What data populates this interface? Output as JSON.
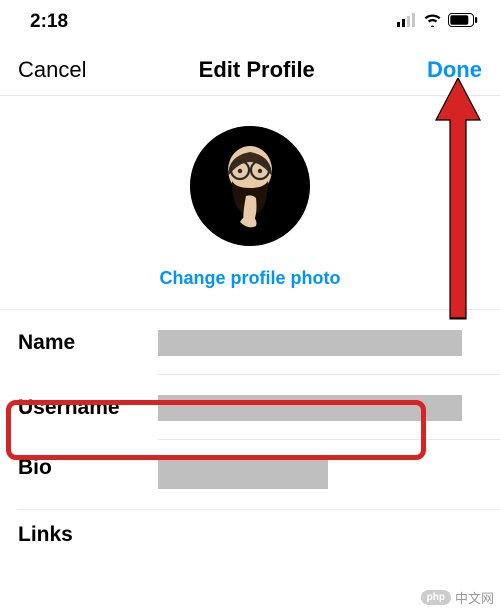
{
  "status": {
    "time": "2:18",
    "signal_icon": "signal",
    "wifi_icon": "wifi",
    "battery_icon": "battery"
  },
  "nav": {
    "cancel": "Cancel",
    "title": "Edit Profile",
    "done": "Done"
  },
  "photo": {
    "change_label": "Change profile photo",
    "avatar_desc": "memoji-avatar"
  },
  "fields": {
    "name": {
      "label": "Name",
      "value": ""
    },
    "username": {
      "label": "Username",
      "value": ""
    },
    "bio": {
      "label": "Bio",
      "value": ""
    },
    "links": {
      "label": "Links",
      "value": ""
    }
  },
  "colors": {
    "accent": "#0095f6",
    "highlight": "#d62424"
  },
  "watermark": {
    "badge": "php",
    "text": "中文网"
  }
}
